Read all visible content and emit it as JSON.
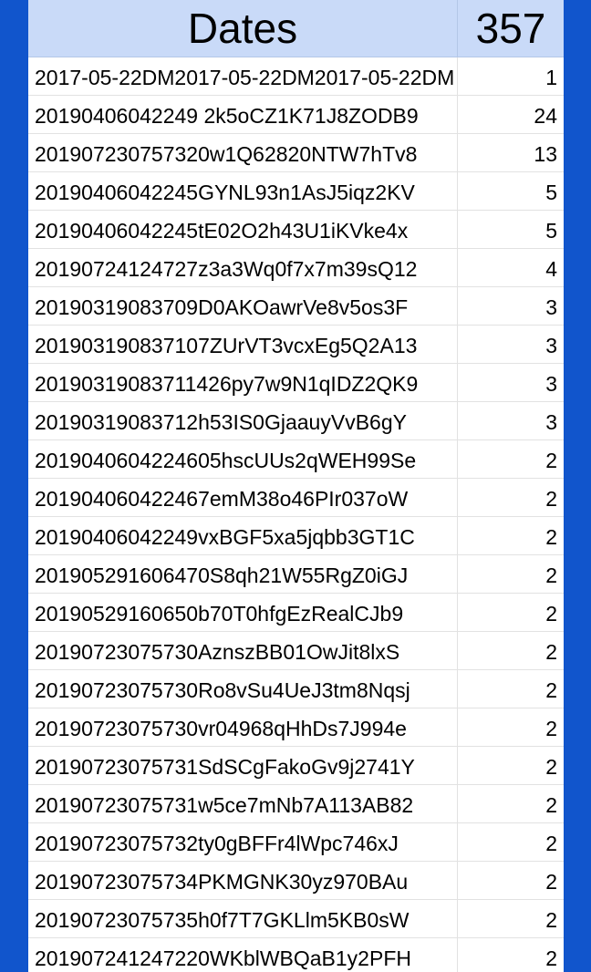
{
  "colors": {
    "background": "#1155cc",
    "header_fill": "#c9daf8",
    "gridline": "#e2e2e2"
  },
  "header": {
    "col_a": "Dates",
    "col_b": "357"
  },
  "rows": [
    {
      "key": "2017-05-22DM2017-05-22DM2017-05-22DM",
      "count": "1"
    },
    {
      "key": "20190406042249 2k5oCZ1K71J8ZODB9",
      "count": "24"
    },
    {
      "key": "201907230757320w1Q62820NTW7hTv8",
      "count": "13"
    },
    {
      "key": "20190406042245GYNL93n1AsJ5iqz2KV",
      "count": "5"
    },
    {
      "key": "20190406042245tE02O2h43U1iKVke4x",
      "count": "5"
    },
    {
      "key": "20190724124727z3a3Wq0f7x7m39sQ12",
      "count": "4"
    },
    {
      "key": "20190319083709D0AKOawrVe8v5os3F",
      "count": "3"
    },
    {
      "key": "201903190837107ZUrVT3vcxEg5Q2A13",
      "count": "3"
    },
    {
      "key": "20190319083711426py7w9N1qIDZ2QK9",
      "count": "3"
    },
    {
      "key": "20190319083712h53IS0GjaauyVvB6gY",
      "count": "3"
    },
    {
      "key": "2019040604224605hscUUs2qWEH99Se",
      "count": "2"
    },
    {
      "key": "201904060422467emM38o46PIr037oW",
      "count": "2"
    },
    {
      "key": "20190406042249vxBGF5xa5jqbb3GT1C",
      "count": "2"
    },
    {
      "key": "201905291606470S8qh21W55RgZ0iGJ",
      "count": "2"
    },
    {
      "key": "20190529160650b70T0hfgEzRealCJb9",
      "count": "2"
    },
    {
      "key": "20190723075730AznszBB01OwJit8lxS",
      "count": "2"
    },
    {
      "key": "20190723075730Ro8vSu4UeJ3tm8Nqsj",
      "count": "2"
    },
    {
      "key": "20190723075730vr04968qHhDs7J994e",
      "count": "2"
    },
    {
      "key": "20190723075731SdSCgFakoGv9j2741Y",
      "count": "2"
    },
    {
      "key": "20190723075731w5ce7mNb7A113AB82",
      "count": "2"
    },
    {
      "key": "20190723075732ty0gBFFr4lWpc746xJ",
      "count": "2"
    },
    {
      "key": "20190723075734PKMGNK30yz970BAu",
      "count": "2"
    },
    {
      "key": "20190723075735h0f7T7GKLlm5KB0sW",
      "count": "2"
    },
    {
      "key": "201907241247220WKblWBQaB1y2PFH",
      "count": "2"
    }
  ]
}
